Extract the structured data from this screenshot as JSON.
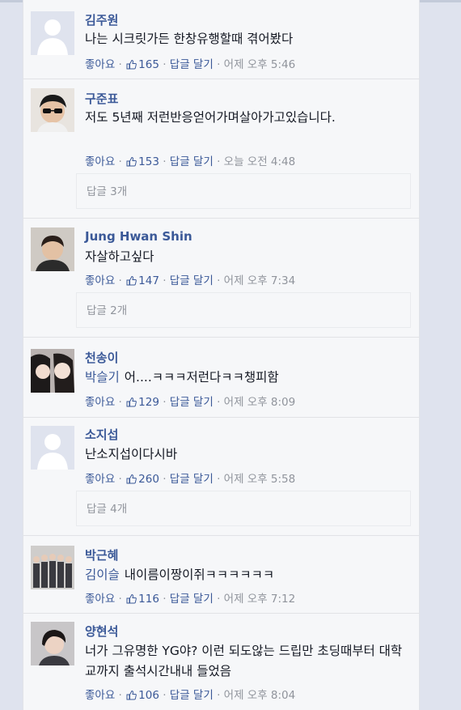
{
  "comments": [
    {
      "author": "김주원",
      "tagged": "",
      "text": "나는 시크릿가든 한창유행할때 겪어봤다",
      "like": "좋아요",
      "likes": "165",
      "reply": "답글 달기",
      "time": "어제 오후 5:46",
      "replies": ""
    },
    {
      "author": "구준표",
      "tagged": "",
      "text": "저도 5년째 저런반응얻어가며살아가고있습니다.",
      "like": "좋아요",
      "likes": "153",
      "reply": "답글 달기",
      "time": "오늘 오전 4:48",
      "replies": "답글 3개"
    },
    {
      "author": "Jung Hwan Shin",
      "tagged": "",
      "text": "자살하고싶다",
      "like": "좋아요",
      "likes": "147",
      "reply": "답글 달기",
      "time": "어제 오후 7:34",
      "replies": "답글 2개"
    },
    {
      "author": "천송이",
      "tagged": "박슬기",
      "text": "어....ㅋㅋㅋ저런다ㅋㅋ챙피함",
      "like": "좋아요",
      "likes": "129",
      "reply": "답글 달기",
      "time": "어제 오후 8:09",
      "replies": ""
    },
    {
      "author": "소지섭",
      "tagged": "",
      "text": "난소지섭이다시바",
      "like": "좋아요",
      "likes": "260",
      "reply": "답글 달기",
      "time": "어제 오후 5:58",
      "replies": "답글 4개"
    },
    {
      "author": "박근혜",
      "tagged": "김이슬",
      "text": "내이름이짱이쥐ㅋㅋㅋㅋㅋㅋ",
      "like": "좋아요",
      "likes": "116",
      "reply": "답글 달기",
      "time": "어제 오후 7:12",
      "replies": ""
    },
    {
      "author": "양현석",
      "tagged": "",
      "text": "너가 그유명한 YG야? 이런 되도않는 드립만 초딩때부터 대학교까지 출석시간내내 들었음",
      "like": "좋아요",
      "likes": "106",
      "reply": "답글 달기",
      "time": "어제 오후 8:04",
      "replies": ""
    }
  ],
  "colors": {
    "link": "#3b5998",
    "text": "#141823",
    "meta": "#90949c",
    "panel": "#f6f7f9"
  },
  "icons": {
    "avatar_default": "default-profile-silhouette-icon",
    "like": "thumbs-up-icon"
  }
}
